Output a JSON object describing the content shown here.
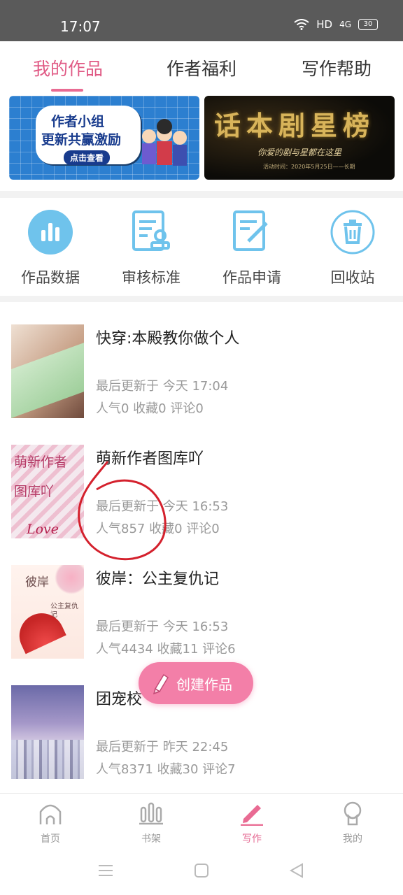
{
  "status_bar": {
    "time": "17:07",
    "network": "HD",
    "signal": "4G",
    "battery": "30"
  },
  "tabs": [
    {
      "label": "我的作品",
      "active": true
    },
    {
      "label": "作者福利",
      "active": false
    },
    {
      "label": "写作帮助",
      "active": false
    }
  ],
  "banners": {
    "left": {
      "line1": "作者小组",
      "line2": "更新共赢激励",
      "button": "点击查看"
    },
    "right": {
      "title": "话本剧星榜",
      "subtitle": "你爱的剧与星都在这里",
      "date": "活动时间：2020年5月25日——长期"
    }
  },
  "quick_actions": [
    {
      "label": "作品数据",
      "icon": "bar-chart-icon"
    },
    {
      "label": "审核标准",
      "icon": "review-doc-icon"
    },
    {
      "label": "作品申请",
      "icon": "apply-edit-icon"
    },
    {
      "label": "回收站",
      "icon": "trash-icon"
    }
  ],
  "works": [
    {
      "title": "快穿:本殿教你做个人",
      "updated": "最后更新于 今天 17:04",
      "stats": "人气0 收藏0 评论0"
    },
    {
      "title": "萌新作者图库吖",
      "updated": "最后更新于 今天 16:53",
      "stats": "人气857 收藏0 评论0",
      "cover_text": "萌新作者 图库吖",
      "cover_love": "Love"
    },
    {
      "title": "彼岸：公主复仇记",
      "updated": "最后更新于 今天 16:53",
      "stats": "人气4434 收藏11 评论6",
      "cover_text": "彼岸",
      "cover_sub": "公主复仇记"
    },
    {
      "title": "团宠校",
      "updated": "最后更新于 昨天 22:45",
      "stats": "人气8371 收藏30 评论7"
    }
  ],
  "fab": {
    "label": "创建作品"
  },
  "bottom_nav": [
    {
      "label": "首页",
      "active": false
    },
    {
      "label": "书架",
      "active": false
    },
    {
      "label": "写作",
      "active": true
    },
    {
      "label": "我的",
      "active": false
    }
  ],
  "colors": {
    "accent": "#e96b93",
    "fab": "#f37fa8",
    "icon_blue": "#6fc3ec"
  }
}
